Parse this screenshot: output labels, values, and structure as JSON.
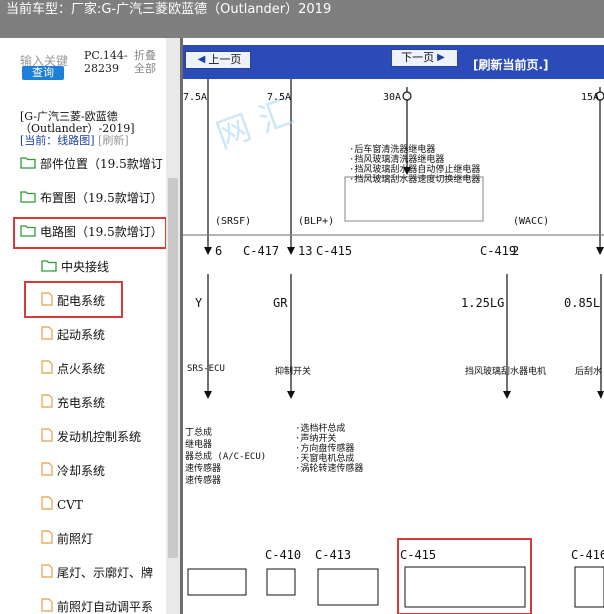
{
  "header": {
    "label": "当前车型：",
    "value": "厂家:G-广汽三菱欧蓝德（Outlander）2019"
  },
  "search": {
    "placeholder": "输入关键",
    "button": "查询"
  },
  "pc_info": {
    "line1": "PC.144-",
    "line2": "28239"
  },
  "fold": {
    "line1": "折叠",
    "line2": "全部"
  },
  "breadcrumb": {
    "path": "[G-广汽三菱-欧蓝德（Outlander）-2019]",
    "current": "[当前：线路图]",
    "refresh": "[刷新]"
  },
  "tree": {
    "folders": [
      {
        "label": "部件位置（19.5款增订"
      },
      {
        "label": "布置图（19.5款增订）"
      },
      {
        "label": "电路图（19.5款增订）"
      },
      {
        "label": "中央接线"
      }
    ],
    "files": [
      {
        "label": "配电系统"
      },
      {
        "label": "起动系统"
      },
      {
        "label": "点火系统"
      },
      {
        "label": "充电系统"
      },
      {
        "label": "发动机控制系统"
      },
      {
        "label": "冷却系统"
      },
      {
        "label": "CVT"
      },
      {
        "label": "前照灯"
      },
      {
        "label": "尾灯、示廓灯、牌"
      },
      {
        "label": "前照灯自动调平系"
      }
    ]
  },
  "toolbar": {
    "prev": "上一页",
    "next": "下一页",
    "refresh": "[刷新当前页.]"
  },
  "schematic": {
    "fuse_labels": [
      "7.5A",
      "7.5A",
      "30A",
      "15A"
    ],
    "relay_notes": [
      "·后车窗清洗器继电器",
      "·挡风玻璃清洗器继电器",
      "·挡风玻璃刮水器自动停止继电器",
      "·挡风玻璃刮水器速度切换继电器"
    ],
    "signals": [
      "(SRSF)",
      "(BLP+)",
      "(WACC)"
    ],
    "pins": [
      {
        "pin": "6",
        "connector": "C-417"
      },
      {
        "pin": "13",
        "connector": "C-415"
      },
      {
        "pin": "2",
        "connector": "C-419"
      }
    ],
    "wire_colors": [
      "Y",
      "GR",
      "1.25LG",
      "0.85L"
    ],
    "destinations": [
      "SRS-ECU",
      "抑制开关",
      "挡风玻璃刮水器电机",
      "后刮水"
    ],
    "notes_left": [
      "丁总成",
      "继电器",
      "器总成 (A/C-ECU)",
      "速传感器",
      "速传感器"
    ],
    "notes_mid": [
      "·选档杆总成",
      "·声纳开关",
      "·方向盘传感器",
      "·天窗电机总成",
      "·涡轮转速传感器"
    ],
    "connectors": [
      "C-410",
      "C-413",
      "C-415",
      "C-416"
    ]
  }
}
